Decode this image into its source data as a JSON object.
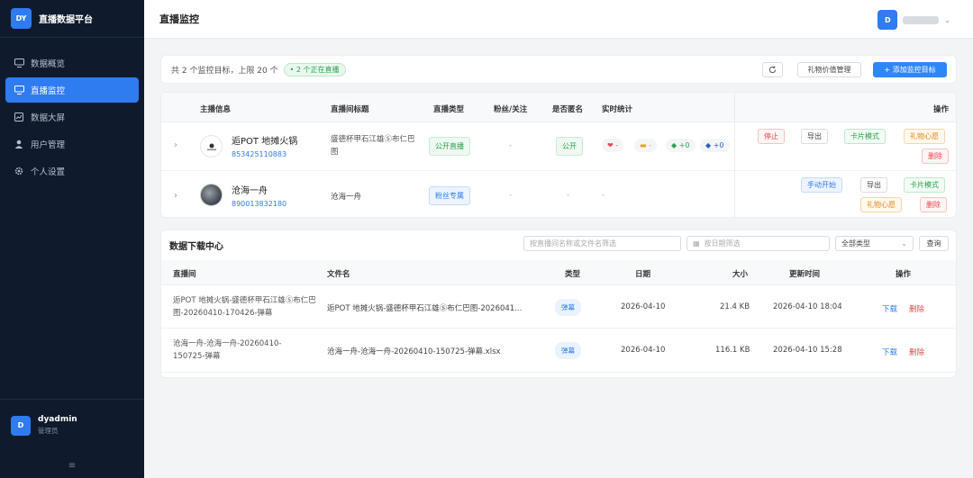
{
  "brand": {
    "logo": "DY",
    "title": "直播数据平台"
  },
  "nav": [
    {
      "icon": "monitor-icon",
      "label": "数据概览",
      "active": false
    },
    {
      "icon": "monitor-icon",
      "label": "直播监控",
      "active": true
    },
    {
      "icon": "chart-icon",
      "label": "数据大屏",
      "active": false
    },
    {
      "icon": "user-icon",
      "label": "用户管理",
      "active": false
    },
    {
      "icon": "gear-icon",
      "label": "个人设置",
      "active": false
    }
  ],
  "sidebar_user": {
    "avatar": "D",
    "name": "dyadmin",
    "role": "管理员",
    "collapse": "≡"
  },
  "header": {
    "title": "直播监控",
    "avatar": "D"
  },
  "toolbar": {
    "summary": "共 2 个监控目标，上限 20 个",
    "live_badge": "• 2 个正在直播",
    "refresh_icon": "refresh-icon",
    "gift_button": "礼物价值管理",
    "add_button": "+ 添加监控目标"
  },
  "monitor": {
    "columns": {
      "streamer": "主播信息",
      "room_title": "直播间标题",
      "type": "直播类型",
      "fans": "粉丝/关注",
      "anon": "是否匿名",
      "stats": "实时统计",
      "ops": "操作"
    },
    "rows": [
      {
        "name": "逅POT 地摊火锅",
        "id": "853425110883",
        "room_title": "盛德杯甲石江雄Ⓢ布仁巴图",
        "type": "公开直播",
        "fans": "-",
        "anon": "公开",
        "stats": {
          "heart": "❤ -",
          "coin": "▬ -",
          "green": "◆ +0",
          "blue": "◆ +0"
        },
        "ops": {
          "stop": "停止",
          "export": "导出",
          "card": "卡片模式",
          "gift": "礼物心愿",
          "delete": "删除"
        }
      },
      {
        "name": "沧海一舟",
        "id": "890013832180",
        "room_title": "沧海一舟",
        "type": "粉丝专属",
        "fans": "-",
        "anon": "-",
        "stats_text": "-",
        "ops": {
          "manual": "手动开始",
          "export": "导出",
          "card": "卡片模式",
          "gift": "礼物心愿",
          "delete": "删除"
        }
      }
    ]
  },
  "download": {
    "title": "数据下载中心",
    "search_placeholder": "按直播间名称或文件名筛选",
    "date_placeholder": "按日期筛选",
    "type_select": "全部类型",
    "query_button": "查询",
    "columns": {
      "room": "直播间",
      "file": "文件名",
      "type": "类型",
      "date": "日期",
      "size": "大小",
      "updated": "更新时间",
      "ops": "操作"
    },
    "rows": [
      {
        "room": "逅POT 地摊火锅-盛德杯甲石江雄Ⓢ布仁巴图-20260410-170426-弹幕",
        "file": "逅POT 地摊火锅-盛德杯甲石江雄Ⓢ布仁巴图-2026041...",
        "type": "弹幕",
        "date": "2026-04-10",
        "size": "21.4 KB",
        "updated": "2026-04-10 18:04",
        "download": "下载",
        "delete": "删除"
      },
      {
        "room": "沧海一舟-沧海一舟-20260410-150725-弹幕",
        "file": "沧海一舟-沧海一舟-20260410-150725-弹幕.xlsx",
        "type": "弹幕",
        "date": "2026-04-10",
        "size": "116.1 KB",
        "updated": "2026-04-10 15:28",
        "download": "下载",
        "delete": "删除"
      }
    ]
  },
  "colors": {
    "accent": "#2f7bf0",
    "sidebar_bg": "#0f1b2d",
    "live_green": "#2ba14d",
    "danger": "#e5484d"
  }
}
